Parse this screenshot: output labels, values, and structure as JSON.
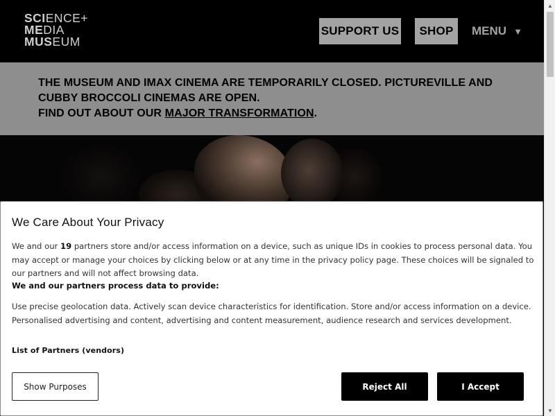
{
  "header": {
    "logo_lines": [
      "SCIENCE+",
      "MEDIA",
      "MUSEUM"
    ],
    "logo_bold": [
      "SCI",
      "ME",
      "MUS"
    ],
    "logo_light": [
      "ENCE+",
      "DIA",
      "EUM"
    ],
    "support_label": "SUPPORT US",
    "shop_label": "SHOP",
    "menu_label": "MENU",
    "menu_icon": "caret-down-icon"
  },
  "banner": {
    "line1": "THE MUSEUM AND IMAX CINEMA ARE TEMPORARILY CLOSED. PICTUREVILLE AND",
    "line2": "CUBBY BROCCOLI CINEMAS ARE OPEN.",
    "line3_prefix": "FIND OUT ABOUT OUR ",
    "link_label": "MAJOR TRANSFORMATION",
    "line3_suffix": "."
  },
  "privacy": {
    "title": "We Care About Your Privacy",
    "desc_prefix": "We and our ",
    "partner_count": "19",
    "desc_suffix": " partners store and/or access information on a device, such as unique IDs in cookies to process personal data. You may accept or manage your choices by clicking below or at any time in the privacy policy page. These choices will be signaled to our partners and will not affect browsing data.",
    "subheading": "We and our partners process data to provide:",
    "purposes": "Use precise geolocation data. Actively scan device characteristics for identification. Store and/or access information on a device. Personalised advertising and content, advertising and content measurement, audience research and services development.",
    "partners_link": "List of Partners (vendors)",
    "show_purposes_label": "Show Purposes",
    "reject_label": "Reject All",
    "accept_label": "I Accept"
  },
  "colors": {
    "header_bg": "#000000",
    "button_bg": "#a3a3a3",
    "banner_bg": "#8e8e8e",
    "dialog_bg": "#ffffff",
    "primary_button": "#000000"
  }
}
